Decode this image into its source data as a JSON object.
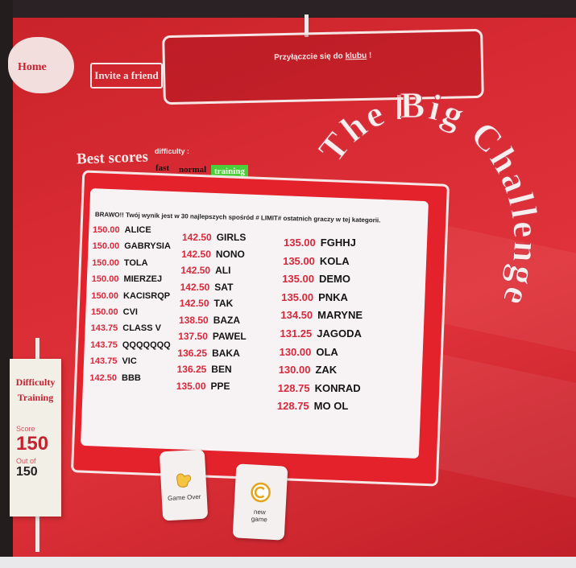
{
  "nav": {
    "home_label": "Home",
    "invite_label": "Invite a friend"
  },
  "banner": {
    "text_before": "Przyłączcie się do",
    "link": "klubu",
    "text_after": " !"
  },
  "title": "The Big Challenge",
  "scores": {
    "heading": "Best scores",
    "difficulty_label": "difficulty :",
    "difficulties": [
      "fast",
      "normal",
      "training"
    ],
    "selected": "training",
    "message": "BRAWO!! Twój wynik jest w 30 najlepszych spośród # LIMIT# ostatnich graczy w tej kategorii.",
    "columns": [
      [
        {
          "score": "150.00",
          "name": "ALICE"
        },
        {
          "score": "150.00",
          "name": "GABRYSIA"
        },
        {
          "score": "150.00",
          "name": "TOLA"
        },
        {
          "score": "150.00",
          "name": "MIERZEJ"
        },
        {
          "score": "150.00",
          "name": "KACISRQP"
        },
        {
          "score": "150.00",
          "name": "CVI"
        },
        {
          "score": "143.75",
          "name": "CLASS V"
        },
        {
          "score": "143.75",
          "name": "QQQQQQQ"
        },
        {
          "score": "143.75",
          "name": "VIC"
        },
        {
          "score": "142.50",
          "name": "BBB"
        }
      ],
      [
        {
          "score": "142.50",
          "name": "GIRLS"
        },
        {
          "score": "142.50",
          "name": "NONO"
        },
        {
          "score": "142.50",
          "name": "ALI"
        },
        {
          "score": "142.50",
          "name": "SAT"
        },
        {
          "score": "142.50",
          "name": "TAK"
        },
        {
          "score": "138.50",
          "name": "BAZA"
        },
        {
          "score": "137.50",
          "name": "PAWEL"
        },
        {
          "score": "136.25",
          "name": "BAKA"
        },
        {
          "score": "136.25",
          "name": "BEN"
        },
        {
          "score": "135.00",
          "name": "PPE"
        }
      ],
      [
        {
          "score": "135.00",
          "name": "FGHHJ"
        },
        {
          "score": "135.00",
          "name": "KOLA"
        },
        {
          "score": "135.00",
          "name": "DEMO"
        },
        {
          "score": "135.00",
          "name": "PNKA"
        },
        {
          "score": "134.50",
          "name": "MARYNE"
        },
        {
          "score": "131.25",
          "name": "JAGODA"
        },
        {
          "score": "130.00",
          "name": "OLA"
        },
        {
          "score": "130.00",
          "name": "ZAK"
        },
        {
          "score": "128.75",
          "name": "KONRAD"
        },
        {
          "score": "128.75",
          "name": "MO OL"
        }
      ]
    ]
  },
  "sign": {
    "difficulty_label": "Difficulty",
    "difficulty_value": "Training",
    "score_label": "Score",
    "score_value": "150",
    "second_label": "Out of",
    "second_value": "150"
  },
  "buttons": {
    "game_over": "Game Over",
    "new_game": "new game"
  },
  "colors": {
    "background": "#d92b33",
    "score_red": "#d8283b",
    "training_green": "#4ccd3a"
  }
}
